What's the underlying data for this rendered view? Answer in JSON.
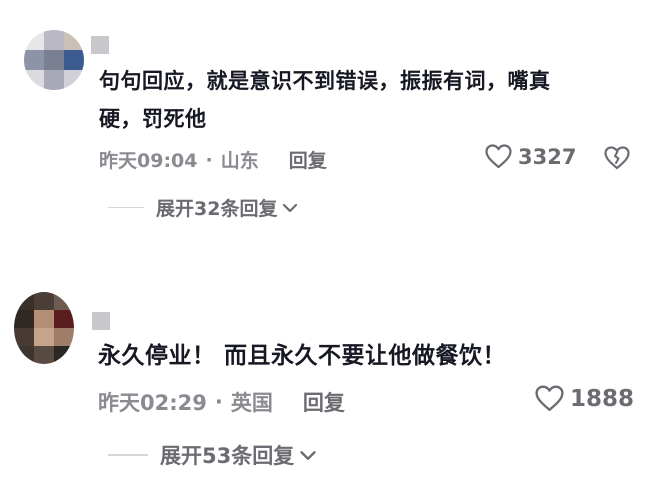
{
  "comments": [
    {
      "text_line1": "句句回应，就是意识不到错误，振振有词，嘴真",
      "text_line2": "硬，罚死他",
      "time": "昨天09:04",
      "separator": "·",
      "location": "山东",
      "reply_label": "回复",
      "likes": "3327",
      "expand_label": "展开32条回复"
    },
    {
      "text_line1": "永久停业！ 而且永久不要让他做餐饮！",
      "text_line2": "",
      "time": "昨天02:29",
      "separator": "·",
      "location": "英国",
      "reply_label": "回复",
      "likes": "1888",
      "expand_label": "展开53条回复"
    }
  ],
  "icons": {
    "like": "heart-outline-icon",
    "dislike": "broken-heart-icon",
    "expand": "chevron-down-icon"
  },
  "colors": {
    "text": "#161823",
    "meta": "#8a8b91",
    "secondary": "#6b6c72"
  }
}
